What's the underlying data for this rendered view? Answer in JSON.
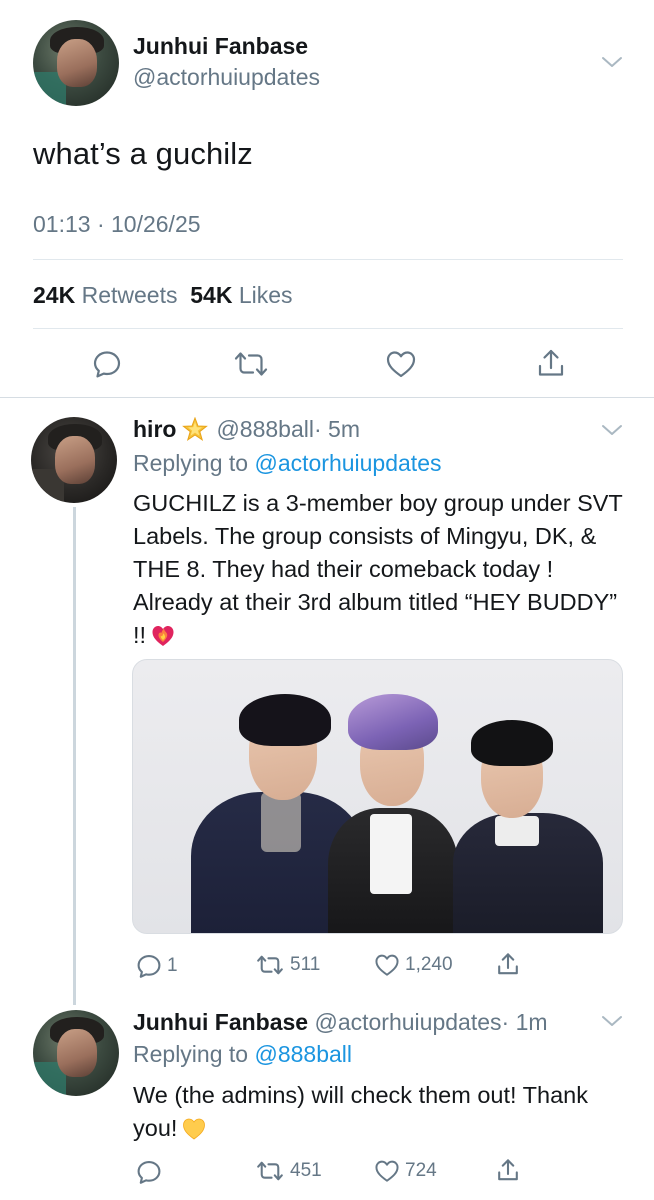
{
  "main_tweet": {
    "display_name": "Junhui Fanbase",
    "handle": "@actorhuiupdates",
    "text": "what’s a guchilz",
    "timestamp": "01:13 · 10/26/25",
    "retweets_count": "24K",
    "retweets_label": "Retweets",
    "likes_count": "54K",
    "likes_label": "Likes",
    "icons": [
      "reply-icon",
      "retweet-icon",
      "like-icon",
      "share-icon"
    ]
  },
  "replies": [
    {
      "display_name": "hiro",
      "name_emoji": "star-emoji",
      "handle": "@888ball",
      "time": "· 5m",
      "replying_prefix": "Replying to",
      "replying_to": "@actorhuiupdates",
      "text": "GUCHILZ is a 3-member boy group under SVT Labels. The group consists of Mingyu, DK, & THE 8. They had their comeback today ! Already at their 3rd album titled “HEY BUDDY” !!",
      "text_emoji": "heart-on-fire-emoji",
      "media": "photo of three people posing together",
      "reply_count": "1",
      "retweet_count": "511",
      "like_count": "1,240"
    },
    {
      "display_name": "Junhui Fanbase",
      "handle": "@actorhuiupdates",
      "time": "· 1m",
      "replying_prefix": "Replying to",
      "replying_to": "@888ball",
      "text": "We (the admins) will check them out! Thank you!",
      "text_emoji": "yellow-heart-emoji",
      "reply_count": "",
      "retweet_count": "451",
      "like_count": "724"
    }
  ],
  "colors": {
    "text": "#14171a",
    "secondary": "#657786",
    "link": "#1b95e0",
    "divider": "#e1e8ed"
  }
}
